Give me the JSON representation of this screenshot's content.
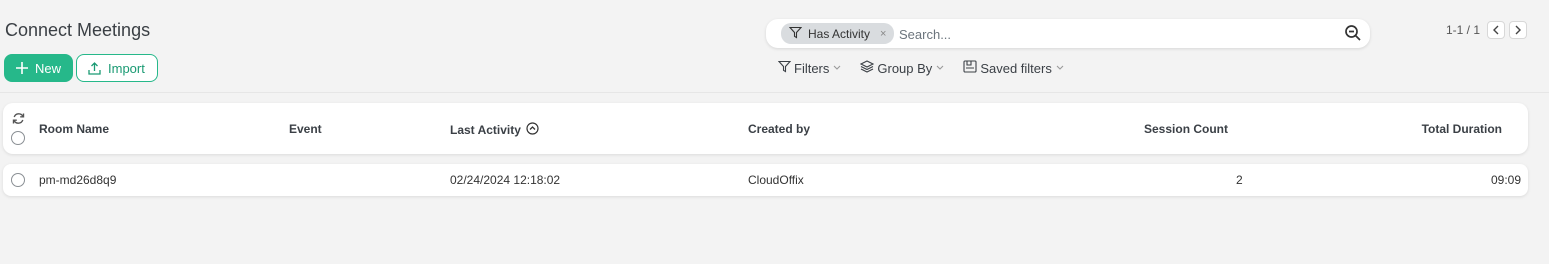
{
  "page": {
    "title": "Connect Meetings"
  },
  "buttons": {
    "new_label": "New",
    "import_label": "Import"
  },
  "search": {
    "facet_label": "Has Activity",
    "facet_remove": "×",
    "placeholder": "Search..."
  },
  "pager": {
    "count": "1-1 / 1"
  },
  "filters": {
    "filters_label": "Filters",
    "group_by_label": "Group By",
    "saved_filters_label": "Saved filters"
  },
  "table": {
    "columns": {
      "room_name": "Room Name",
      "event": "Event",
      "last_activity": "Last Activity",
      "created_by": "Created by",
      "session_count": "Session Count",
      "total_duration": "Total Duration"
    },
    "rows": [
      {
        "room_name": "pm-md26d8q9",
        "event": "",
        "last_activity": "02/24/2024 12:18:02",
        "created_by": "CloudOffix",
        "session_count": "2",
        "total_duration": "09:09"
      }
    ]
  },
  "colors": {
    "primary": "#26b88a",
    "background": "#f3f3f3"
  }
}
